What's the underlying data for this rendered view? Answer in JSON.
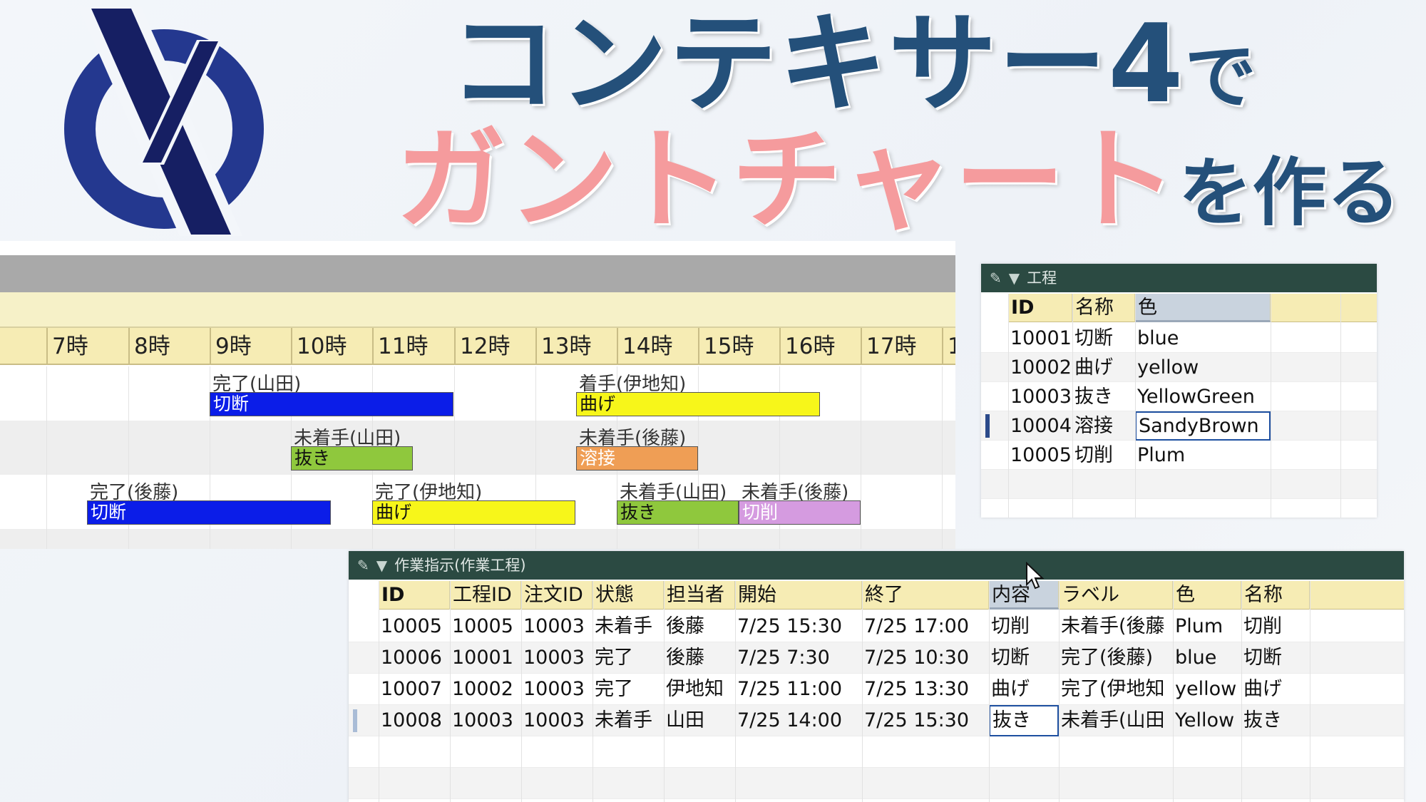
{
  "title": {
    "line1_main": "コンテキサー4",
    "line1_suffix": "で",
    "line2_main": "ガントチャート",
    "line2_suffix": "を作る"
  },
  "colors": {
    "title_navy": "#24507a",
    "title_pink": "#f59b9d",
    "panel_bar": "#2b4a42",
    "header_yellow": "#f6ecb4",
    "bar_blue": "#0b1de8",
    "bar_yellow": "#f7f61a",
    "bar_yellowgreen": "#8fc83d",
    "bar_sandybrown": "#ef9e55",
    "bar_plum": "#d59be0"
  },
  "gantt": {
    "hours": [
      "時",
      "7時",
      "8時",
      "9時",
      "10時",
      "11時",
      "12時",
      "13時",
      "14時",
      "15時",
      "16時",
      "17時",
      "1"
    ],
    "rows": [
      {
        "tasks": [
          {
            "label": "完了(山田)",
            "bar": "切断",
            "color": "blue"
          },
          {
            "label": "着手(伊地知)",
            "bar": "曲げ",
            "color": "yellow"
          }
        ]
      },
      {
        "tasks": [
          {
            "label": "未着手(山田)",
            "bar": "抜き",
            "color": "yellowgreen"
          },
          {
            "label": "未着手(後藤)",
            "bar": "溶接",
            "color": "sandybrown"
          }
        ]
      },
      {
        "tasks": [
          {
            "label": "完了(後藤)",
            "bar": "切断",
            "color": "blue"
          },
          {
            "label": "完了(伊地知)",
            "bar": "曲げ",
            "color": "yellow"
          },
          {
            "label": "未着手(山田)",
            "bar": "抜き",
            "color": "yellowgreen"
          },
          {
            "label": "未着手(後藤)",
            "bar": "切削",
            "color": "plum"
          }
        ]
      }
    ]
  },
  "process_panel": {
    "title": "工程",
    "headers": [
      "ID",
      "名称",
      "色"
    ],
    "rows": [
      [
        "10001",
        "切断",
        "blue"
      ],
      [
        "10002",
        "曲げ",
        "yellow"
      ],
      [
        "10003",
        "抜き",
        "YellowGreen"
      ],
      [
        "10004",
        "溶接",
        "SandyBrown"
      ],
      [
        "10005",
        "切削",
        "Plum"
      ]
    ]
  },
  "work_panel": {
    "title": "作業指示(作業工程)",
    "headers": [
      "ID",
      "工程ID",
      "注文ID",
      "状態",
      "担当者",
      "開始",
      "終了",
      "内容",
      "ラベル",
      "色",
      "名称"
    ],
    "rows": [
      [
        "10005",
        "10005",
        "10003",
        "未着手",
        "後藤",
        "7/25 15:30",
        "7/25 17:00",
        "切削",
        "未着手(後藤",
        "Plum",
        "切削"
      ],
      [
        "10006",
        "10001",
        "10003",
        "完了",
        "後藤",
        "7/25 7:30",
        "7/25 10:30",
        "切断",
        "完了(後藤)",
        "blue",
        "切断"
      ],
      [
        "10007",
        "10002",
        "10003",
        "完了",
        "伊地知",
        "7/25 11:00",
        "7/25 13:30",
        "曲げ",
        "完了(伊地知",
        "yellow",
        "曲げ"
      ],
      [
        "10008",
        "10003",
        "10003",
        "未着手",
        "山田",
        "7/25 14:00",
        "7/25 15:30",
        "抜き",
        "未着手(山田",
        "Yellow",
        "抜き"
      ]
    ]
  }
}
